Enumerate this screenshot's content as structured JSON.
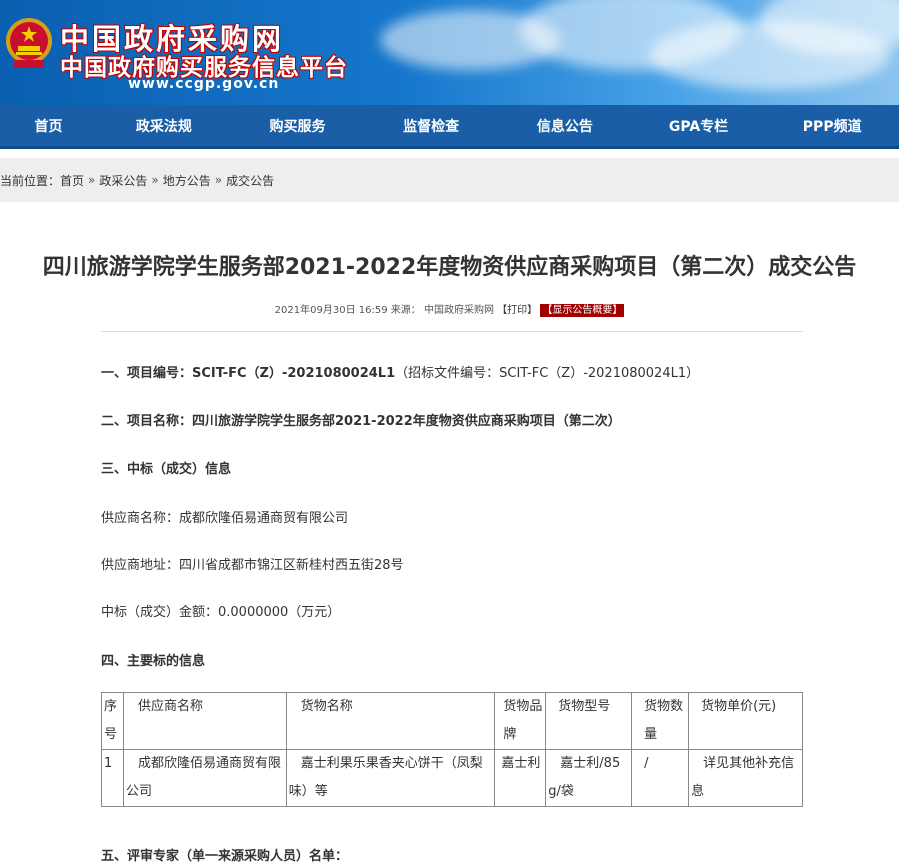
{
  "header": {
    "title": "中国政府采购网",
    "subtitle": "中国政府购买服务信息平台",
    "url": "www.ccgp.gov.cn"
  },
  "nav": [
    "首页",
    "政采法规",
    "购买服务",
    "监督检查",
    "信息公告",
    "GPA专栏",
    "PPP频道"
  ],
  "breadcrumb": {
    "prefix": "当前位置：",
    "items": [
      "首页",
      "政采公告",
      "地方公告",
      "成交公告"
    ],
    "separator": "»"
  },
  "article": {
    "title": "四川旅游学院学生服务部2021-2022年度物资供应商采购项目（第二次）成交公告",
    "date": "2021年09月30日 16:59",
    "source_label": "来源：",
    "source": "中国政府采购网",
    "print": "【打印】",
    "summary": "【显示公告概要】"
  },
  "sections": {
    "s1_label": "一、项目编号：",
    "s1_value": "SCIT-FC（Z）-2021080024L1",
    "s1_extra": "（招标文件编号：SCIT-FC（Z）-2021080024L1）",
    "s2": "二、项目名称：四川旅游学院学生服务部2021-2022年度物资供应商采购项目（第二次）",
    "s3": "三、中标（成交）信息",
    "supplier_name": "供应商名称：成都欣隆佰易通商贸有限公司",
    "supplier_addr": "供应商地址：四川省成都市锦江区新桂村西五街28号",
    "amount": "中标（成交）金额：0.0000000（万元）",
    "s4": "四、主要标的信息",
    "s5": "五、评审专家（单一来源采购人员）名单："
  },
  "table": {
    "headers": [
      "序号",
      "供应商名称",
      "货物名称",
      "货物品牌",
      "货物型号",
      "货物数量",
      "货物单价(元)"
    ],
    "rows": [
      [
        "1",
        "成都欣隆佰易通商贸有限公司",
        "嘉士利果乐果香夹心饼干（凤梨味）等",
        "嘉士利",
        "嘉士利/85g/袋",
        "/",
        "详见其他补充信息"
      ]
    ]
  },
  "colors": {
    "nav_bg": "#1a5ea8",
    "summary_badge": "#a00000",
    "breadcrumb_bg": "#eeeeee"
  },
  "icons": [
    "national-emblem-icon"
  ]
}
